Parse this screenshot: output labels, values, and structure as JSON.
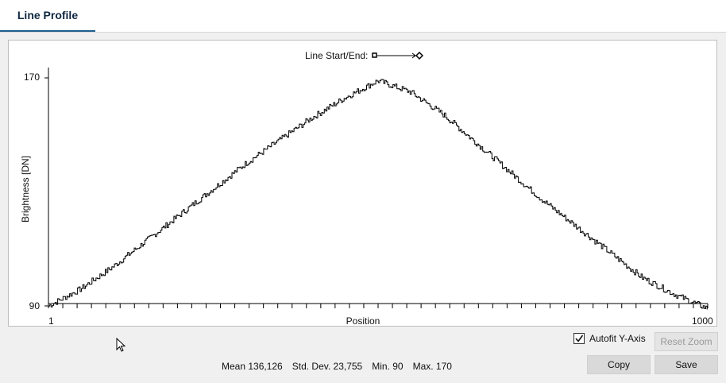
{
  "tabs": [
    {
      "label": "Line Profile",
      "active": true
    }
  ],
  "legend": {
    "label": "Line Start/End:",
    "icon": "line-start-end-icon"
  },
  "chart_data": {
    "type": "line",
    "xlabel": "Position",
    "ylabel": "Brightness [DN]",
    "xlim": [
      1,
      1000
    ],
    "ylim": [
      90,
      170
    ],
    "x_tick_labels": [
      "1",
      "1000"
    ],
    "y_tick_labels": [
      "170",
      "90"
    ],
    "grid": false,
    "line_color": "#000000",
    "series": [
      {
        "x": [
          1,
          50,
          100,
          150,
          200,
          250,
          300,
          350,
          400,
          450,
          500,
          550,
          600,
          650,
          700,
          750,
          800,
          850,
          900,
          950,
          1000
        ],
        "y": [
          90,
          96,
          104,
          113,
          122,
          131,
          140,
          148,
          156,
          163,
          169,
          165,
          157,
          147,
          137,
          127,
          118,
          109,
          100,
          94,
          89
        ]
      }
    ]
  },
  "controls": {
    "autofit_label": "Autofit Y-Axis",
    "autofit_checked": true,
    "reset_zoom_label": "Reset Zoom",
    "copy_label": "Copy",
    "save_label": "Save"
  },
  "stats": {
    "mean": "Mean 136,126",
    "std_dev": "Std. Dev. 23,755",
    "min": "Min. 90",
    "max": "Max. 170"
  }
}
